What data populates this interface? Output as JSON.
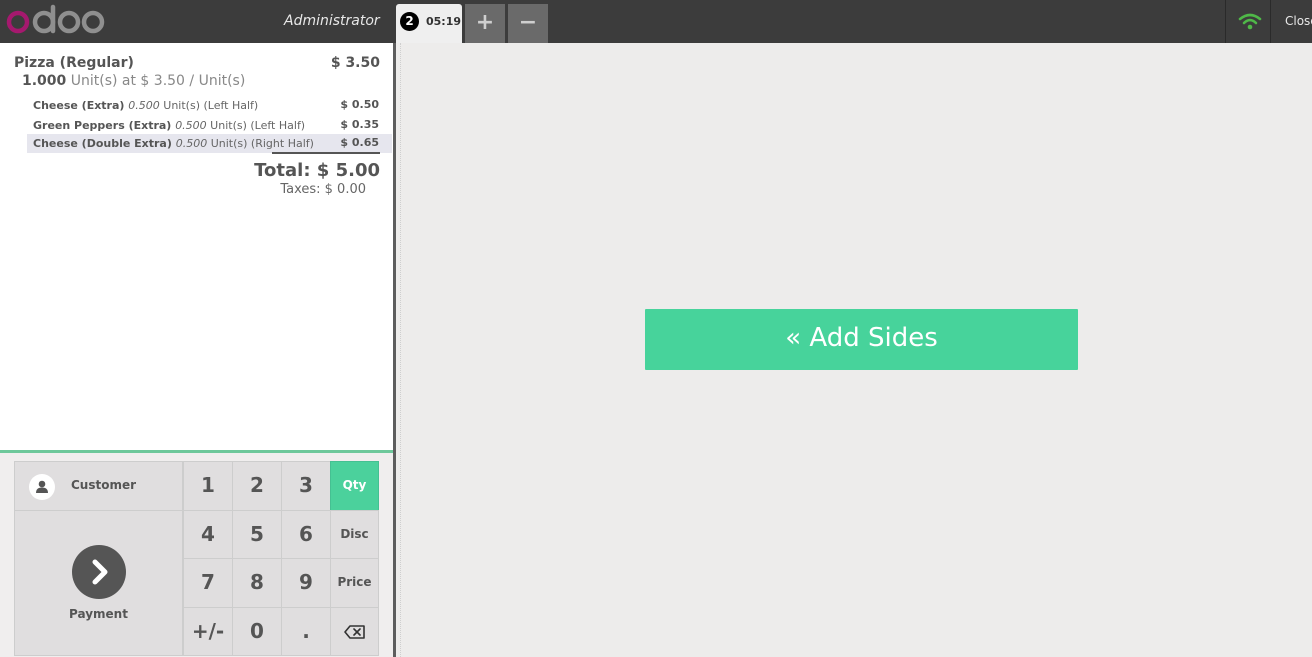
{
  "header": {
    "user": "Administrator",
    "order_number": "2",
    "order_time": "05:19",
    "add_order_label": "+",
    "remove_order_label": "−",
    "close_label": "Close",
    "connection_status_icon": "wifi-icon"
  },
  "order": {
    "line": {
      "name": "Pizza (Regular)",
      "price": "$ 3.50",
      "qty": "1.000",
      "detail": " Unit(s) at $ 3.50 / Unit(s)"
    },
    "sublines": [
      {
        "name": "Cheese (Extra)",
        "qty": "0.500",
        "detail": " Unit(s) (Left Half)",
        "price": "$ 0.50"
      },
      {
        "name": "Green Peppers (Extra)",
        "qty": "0.500",
        "detail": " Unit(s) (Left Half)",
        "price": "$ 0.35"
      },
      {
        "name": "Cheese (Double Extra)",
        "qty": "0.500",
        "detail": " Unit(s) (Right Half)",
        "price": "$ 0.65"
      }
    ],
    "total": "Total: $ 5.00",
    "taxes": "Taxes: $ 0.00"
  },
  "controls": {
    "customer_label": "Customer",
    "payment_label": "Payment",
    "numpad": {
      "k1": "1",
      "k2": "2",
      "k3": "3",
      "k4": "4",
      "k5": "5",
      "k6": "6",
      "k7": "7",
      "k8": "8",
      "k9": "9",
      "sign": "+/-",
      "k0": "0",
      "dot": "."
    },
    "modes": {
      "qty": "Qty",
      "disc": "Disc",
      "price": "Price"
    },
    "active_mode": "Qty",
    "accent_color": "#4bd19c"
  },
  "main": {
    "add_sides_label": "« Add Sides"
  }
}
